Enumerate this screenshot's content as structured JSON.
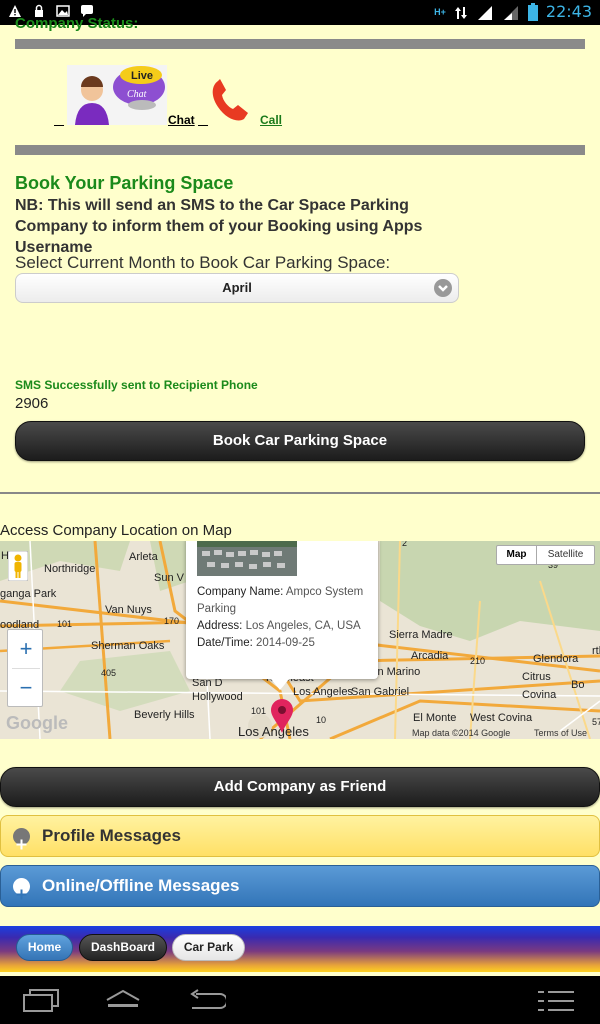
{
  "statusbar": {
    "network": "H+",
    "time": "22:43"
  },
  "company_status_label": "Company Status:",
  "contact": {
    "chat_label": "Chat",
    "call_label": "Call",
    "live_label": "Live",
    "chat_bubble_label": "Chat"
  },
  "booking": {
    "title": "Book Your Parking Space",
    "note": "NB: This will send an SMS to the Car Space Parking Company to inform them of your Booking using Apps Username",
    "select_label": "Select Current Month to Book Car Parking Space:",
    "selected_month": "April",
    "sms_status": "SMS Successfully sent to Recipient Phone",
    "sms_code": "2906",
    "book_button": "Book Car Parking Space"
  },
  "map": {
    "section_label": "Access Company Location on Map",
    "map_tab": "Map",
    "satellite_tab": "Satellite",
    "zoom_in": "+",
    "zoom_out": "−",
    "popup": {
      "company_label": "Company Name:",
      "company_value": "Ampco System Parking",
      "address_label": "Address:",
      "address_value": "Los Angeles, CA, USA",
      "datetime_label": "Date/Time:",
      "datetime_value": "2014-09-25"
    },
    "places": [
      "Northridge",
      "Arleta",
      "Sun V",
      "Van Nuys",
      "Sherman Oaks",
      "Hollywood",
      "Beverly Hills",
      "Los Angeles",
      "Sierra Madre",
      "Arcadia",
      "Glendora",
      "Citrus",
      "Covina",
      "San Marino",
      "San Gabriel",
      "El Monte",
      "West Covina",
      "Northeast",
      "Los Angeles",
      "ganga Park",
      "oodland",
      "rth",
      "San D",
      "Hills",
      "Bo"
    ],
    "highways": [
      "170",
      "101",
      "405",
      "2",
      "39",
      "210",
      "101",
      "10",
      "57"
    ],
    "google_logo": "Google",
    "attribution": "Map data ©2014 Google",
    "terms": "Terms of Use"
  },
  "add_friend_button": "Add Company as Friend",
  "profile_messages": "Profile Messages",
  "online_messages": "Online/Offline Messages",
  "nav": {
    "home": "Home",
    "dashboard": "DashBoard",
    "carpark": "Car Park"
  },
  "colors": {
    "accent_green": "#1b8a1b",
    "profile_bg": "#ffe066",
    "online_bg": "#3f86c7"
  }
}
